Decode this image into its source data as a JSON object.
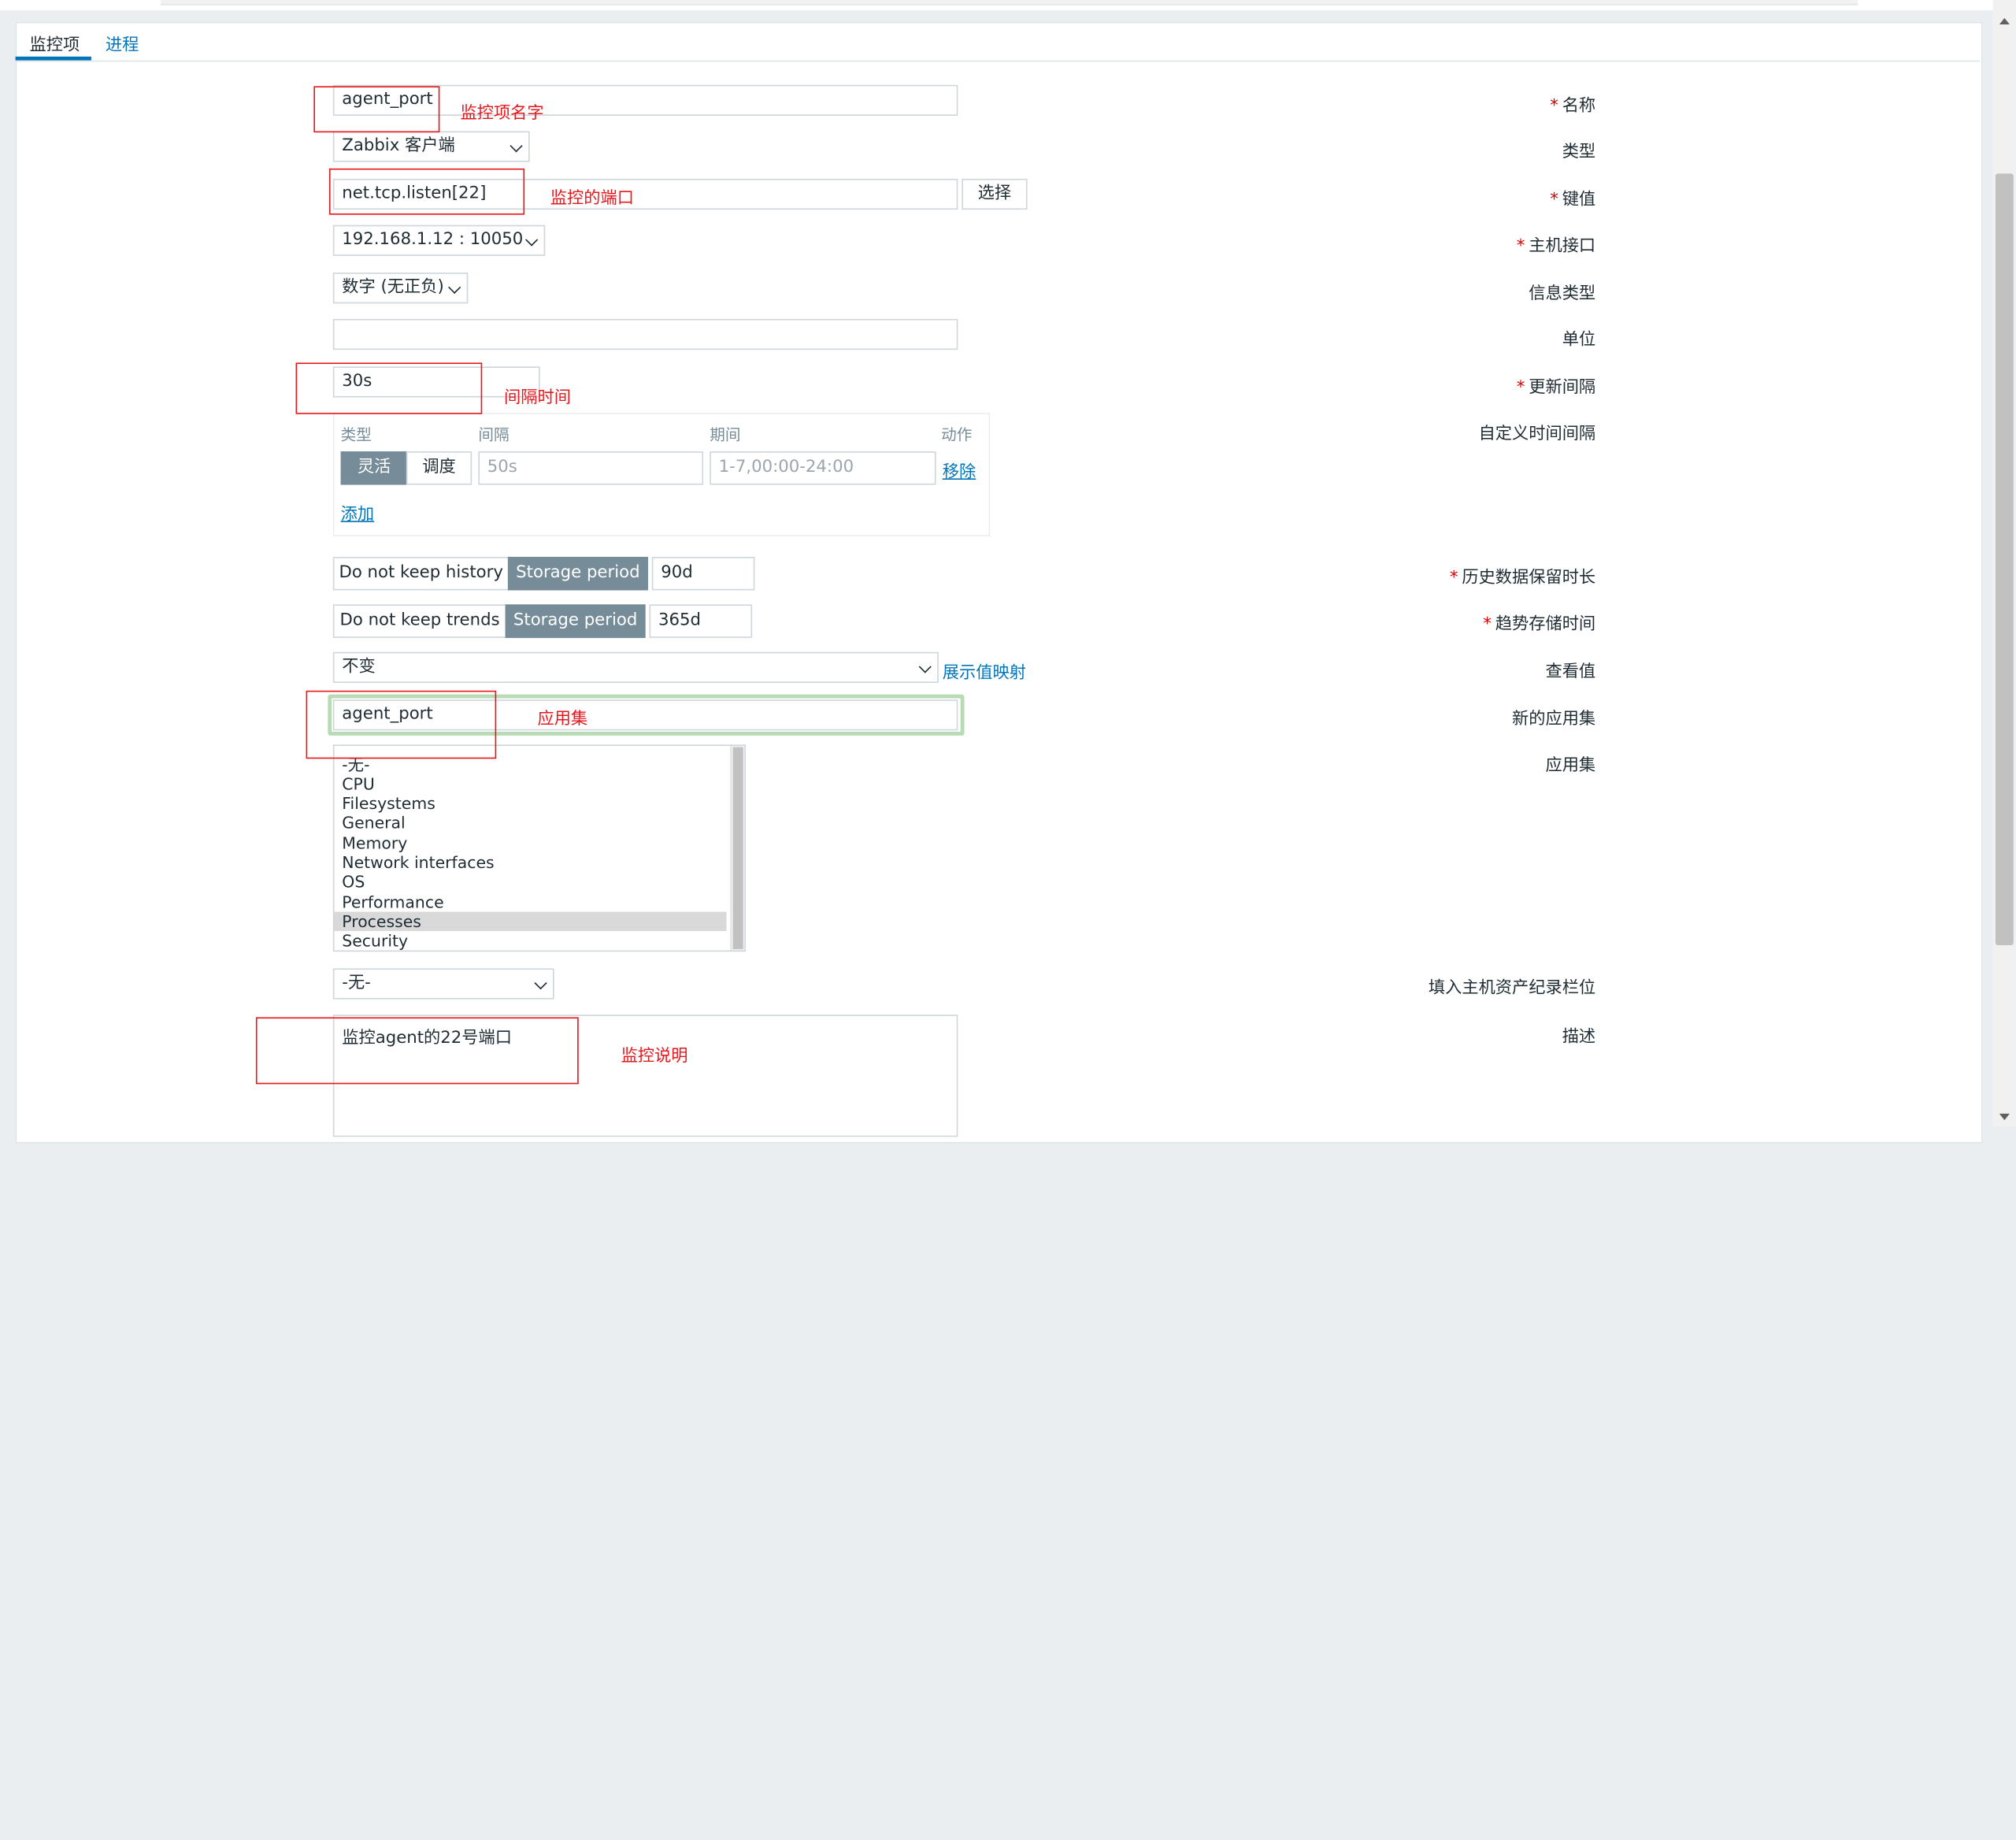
{
  "tabs": [
    {
      "label": "监控项"
    },
    {
      "label": "进程"
    }
  ],
  "form": {
    "name": {
      "label": "名称",
      "value": "agent_port"
    },
    "type": {
      "label": "类型",
      "value": "Zabbix 客户端"
    },
    "key": {
      "label": "键值",
      "value": "net.tcp.listen[22]",
      "select_button": "选择"
    },
    "interface": {
      "label": "主机接口",
      "value": "192.168.1.12 : 10050"
    },
    "info_type": {
      "label": "信息类型",
      "value": "数字 (无正负)"
    },
    "unit": {
      "label": "单位",
      "value": ""
    },
    "update_interval": {
      "label": "更新间隔",
      "value": "30s"
    },
    "custom_intervals": {
      "label": "自定义时间间隔",
      "headers": {
        "type": "类型",
        "interval": "间隔",
        "period": "期间",
        "action": "动作"
      },
      "type_flexible": "灵活",
      "type_scheduling": "调度",
      "interval_placeholder": "50s",
      "period_placeholder": "1-7,00:00-24:00",
      "remove": "移除",
      "add": "添加"
    },
    "history": {
      "label": "历史数据保留时长",
      "no_keep": "Do not keep history",
      "storage": "Storage period",
      "value": "90d"
    },
    "trends": {
      "label": "趋势存储时间",
      "no_keep": "Do not keep trends",
      "storage": "Storage period",
      "value": "365d"
    },
    "show_value": {
      "label": "查看值",
      "value": "不变",
      "link": "展示值映射"
    },
    "new_application": {
      "label": "新的应用集",
      "value": "agent_port"
    },
    "applications": {
      "label": "应用集",
      "items": [
        "-无-",
        "CPU",
        "Filesystems",
        "General",
        "Memory",
        "Network interfaces",
        "OS",
        "Performance",
        "Processes",
        "Security"
      ],
      "selected": "Processes"
    },
    "inventory": {
      "label": "填入主机资产纪录栏位",
      "value": "-无-"
    },
    "description": {
      "label": "描述",
      "value": "监控agent的22号端口"
    }
  },
  "annotations": {
    "name": "监控项名字",
    "key": "监控的端口",
    "interval": "间隔时间",
    "application": "应用集",
    "description": "监控说明"
  },
  "colors": {
    "annotation": "#e8171c",
    "link": "#0275b8",
    "segment_active": "#768d99"
  }
}
